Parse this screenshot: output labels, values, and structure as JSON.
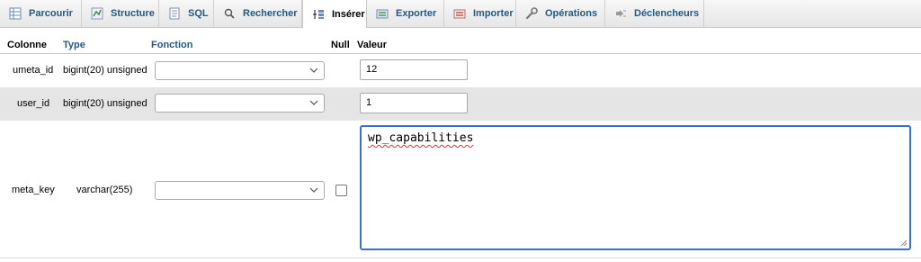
{
  "tabs": [
    {
      "label": "Parcourir",
      "icon": "browse-icon"
    },
    {
      "label": "Structure",
      "icon": "structure-icon"
    },
    {
      "label": "SQL",
      "icon": "sql-icon"
    },
    {
      "label": "Rechercher",
      "icon": "search-icon"
    },
    {
      "label": "Insérer",
      "icon": "insert-icon",
      "active": true
    },
    {
      "label": "Exporter",
      "icon": "export-icon"
    },
    {
      "label": "Importer",
      "icon": "import-icon"
    },
    {
      "label": "Opérations",
      "icon": "wrench-icon"
    },
    {
      "label": "Déclencheurs",
      "icon": "triggers-icon"
    }
  ],
  "table": {
    "headers": {
      "colonne": "Colonne",
      "type": "Type",
      "fonction": "Fonction",
      "null": "Null",
      "valeur": "Valeur"
    },
    "rows": [
      {
        "column": "umeta_id",
        "type": "bigint(20) unsigned",
        "function": "",
        "value": "12"
      },
      {
        "column": "user_id",
        "type": "bigint(20) unsigned",
        "function": "",
        "value": "1"
      },
      {
        "column": "meta_key",
        "type": "varchar(255)",
        "function": "",
        "null_checked": false,
        "value": "wp_capabilities"
      }
    ]
  },
  "colors": {
    "link": "#235a81",
    "active_tab_bg": "#ffffff",
    "row_alt_bg": "#e5e5e5",
    "focus_border": "#3a6fcf"
  }
}
